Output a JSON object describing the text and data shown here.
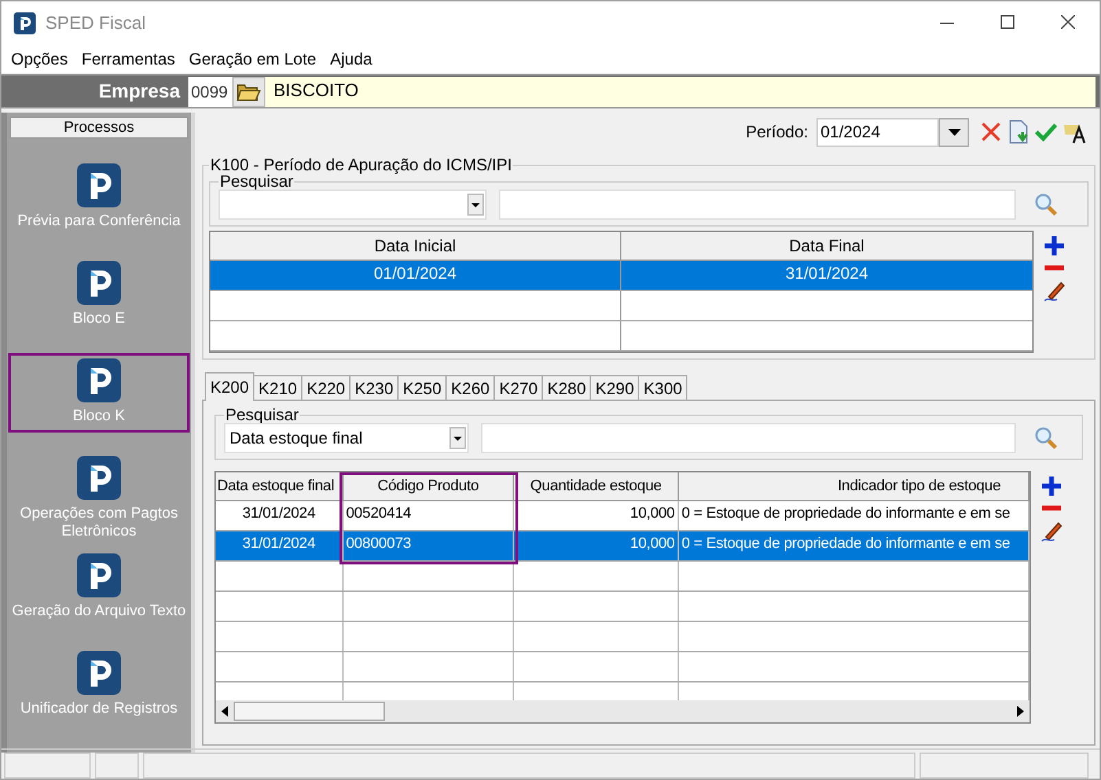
{
  "window": {
    "title": "SPED Fiscal"
  },
  "menu": [
    "Opções",
    "Ferramentas",
    "Geração em Lote",
    "Ajuda"
  ],
  "empresa": {
    "label": "Empresa",
    "code": "0099",
    "name": "BISCOITO"
  },
  "sidebar": {
    "header": "Processos",
    "items": [
      {
        "label": "Prévia para Conferência",
        "selected": false
      },
      {
        "label": "Bloco E",
        "selected": false
      },
      {
        "label": "Bloco K",
        "selected": true
      },
      {
        "label": "Operações com Pagtos Eletrônicos",
        "selected": false
      },
      {
        "label": "Geração do Arquivo Texto",
        "selected": false
      },
      {
        "label": "Unificador de Registros",
        "selected": false
      }
    ]
  },
  "periodo": {
    "label": "Período:",
    "value": "01/2024"
  },
  "k100": {
    "title": "K100 - Período de Apuração do ICMS/IPI",
    "search_label": "Pesquisar",
    "columns": [
      "Data Inicial",
      "Data Final"
    ],
    "rows": [
      {
        "cells": [
          "01/01/2024",
          "31/01/2024"
        ],
        "selected": true
      }
    ]
  },
  "tabs": [
    {
      "label": "K200",
      "selected": true
    },
    {
      "label": "K210",
      "selected": false
    },
    {
      "label": "K220",
      "selected": false
    },
    {
      "label": "K230",
      "selected": false
    },
    {
      "label": "K250",
      "selected": false
    },
    {
      "label": "K260",
      "selected": false
    },
    {
      "label": "K270",
      "selected": false
    },
    {
      "label": "K280",
      "selected": false
    },
    {
      "label": "K290",
      "selected": false
    },
    {
      "label": "K300",
      "selected": false
    }
  ],
  "k200": {
    "search_label": "Pesquisar",
    "search_field": "Data estoque final",
    "columns": [
      {
        "label": "Data estoque final",
        "highlighted": false
      },
      {
        "label": "Código Produto",
        "highlighted": true
      },
      {
        "label": "Quantidade estoque",
        "highlighted": false
      },
      {
        "label": "Indicador tipo de estoque",
        "highlighted": false
      }
    ],
    "rows": [
      {
        "cells": [
          "31/01/2024",
          "00520414",
          "10,000",
          "0 = Estoque de propriedade do informante e em se"
        ],
        "selected": false
      },
      {
        "cells": [
          "31/01/2024",
          "00800073",
          "10,000",
          "0 = Estoque de propriedade do informante e em se"
        ],
        "selected": true
      }
    ]
  }
}
